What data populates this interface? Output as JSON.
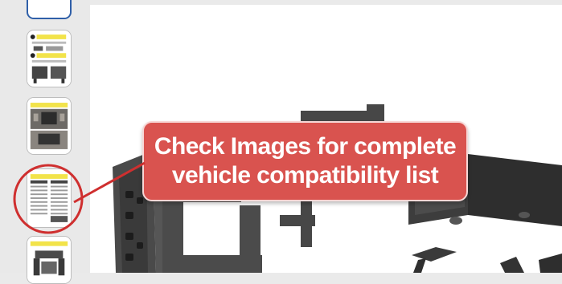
{
  "gallery": {
    "thumbnails": [
      {
        "name": "thumbnail-top-partial",
        "selected": true
      },
      {
        "name": "thumbnail-install-instructions"
      },
      {
        "name": "thumbnail-vehicle-fit-photos"
      },
      {
        "name": "thumbnail-compatibility-list",
        "highlighted": true
      },
      {
        "name": "thumbnail-kit-parts"
      }
    ]
  },
  "callout": {
    "line1": "Check Images for complete",
    "line2": "vehicle compatibility list"
  },
  "colors": {
    "callout_fill": "#d9534f",
    "highlight_ring": "#cf2f2f",
    "thumb_yellow": "#f2e34a",
    "bracket": "#3f3f3f"
  }
}
